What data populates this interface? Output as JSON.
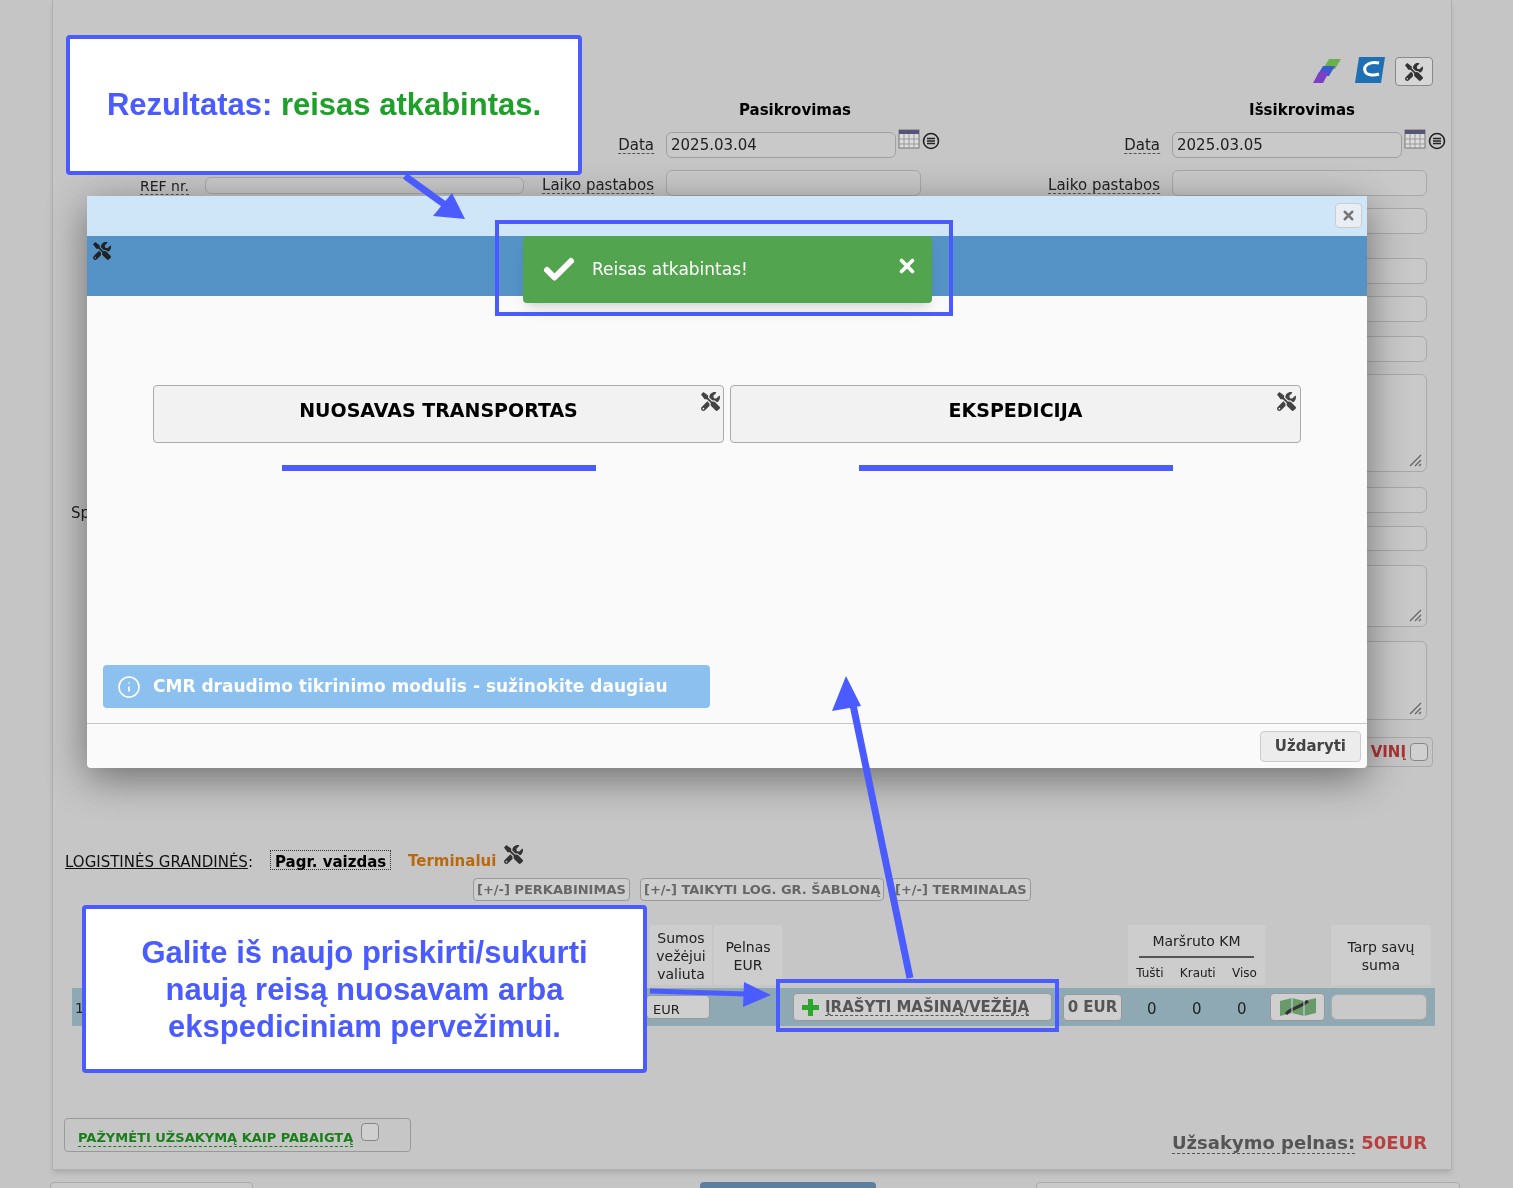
{
  "loading": {
    "title": "Pasikrovimas",
    "date_label": "Data",
    "date": "2025.03.04",
    "notes_label": "Laiko pastabos"
  },
  "unloading": {
    "title": "Išsikrovimas",
    "date_label": "Data",
    "date": "2025.03.05",
    "notes_label": "Laiko pastabos"
  },
  "ref_label": "REF nr.",
  "cut_label": "Sp",
  "side_checkbox": {
    "label": "VINĮ",
    "checked": false
  },
  "modal": {
    "toast": "Reisas atkabintas!",
    "options": [
      {
        "label": "NUOSAVAS TRANSPORTAS"
      },
      {
        "label": "EKSPEDICIJA"
      }
    ],
    "info_banner": "CMR draudimo tikrinimo modulis - sužinokite daugiau",
    "close_button": "Uždaryti"
  },
  "logistics": {
    "label": "LOGISTINĖS GRANDINĖS",
    "separator": ":",
    "views": [
      {
        "label": "Pagr. vaizdas",
        "selected": true
      },
      {
        "label": "Terminalui",
        "selected": false
      }
    ],
    "actions": [
      "[+/-] PERKABINIMAS",
      "[+/-] TAIKYTI LOG. GR. ŠABLONĄ",
      "[+/-] TERMINALAS"
    ]
  },
  "table": {
    "headers": [
      "Sumos vežėjui valiuta",
      "Pelnas EUR"
    ],
    "km_header": "Maršruto KM",
    "km_columns": [
      "Tušti",
      "Krauti",
      "Viso"
    ],
    "last_header": "Tarp savų suma",
    "row": {
      "number": "1",
      "currency": "EUR",
      "add_button": "ĮRAŠYTI MAŠINĄ/VEŽĖJĄ",
      "amount": "0 EUR",
      "km": [
        "0",
        "0",
        "0"
      ]
    }
  },
  "finish": {
    "label": "PAŽYMĖTI UŽSAKYMĄ KAIP PABAIGTĄ",
    "checked": false
  },
  "profit": {
    "label": "Užsakymo pelnas:",
    "value": "50EUR"
  },
  "annotations": {
    "result": {
      "lead": "Rezultatas:",
      "text": "reisas atkabintas."
    },
    "hint": "Galite iš naujo priskirti/sukurti naują reisą nuosavam arba ekspediciniam pervežimui."
  }
}
